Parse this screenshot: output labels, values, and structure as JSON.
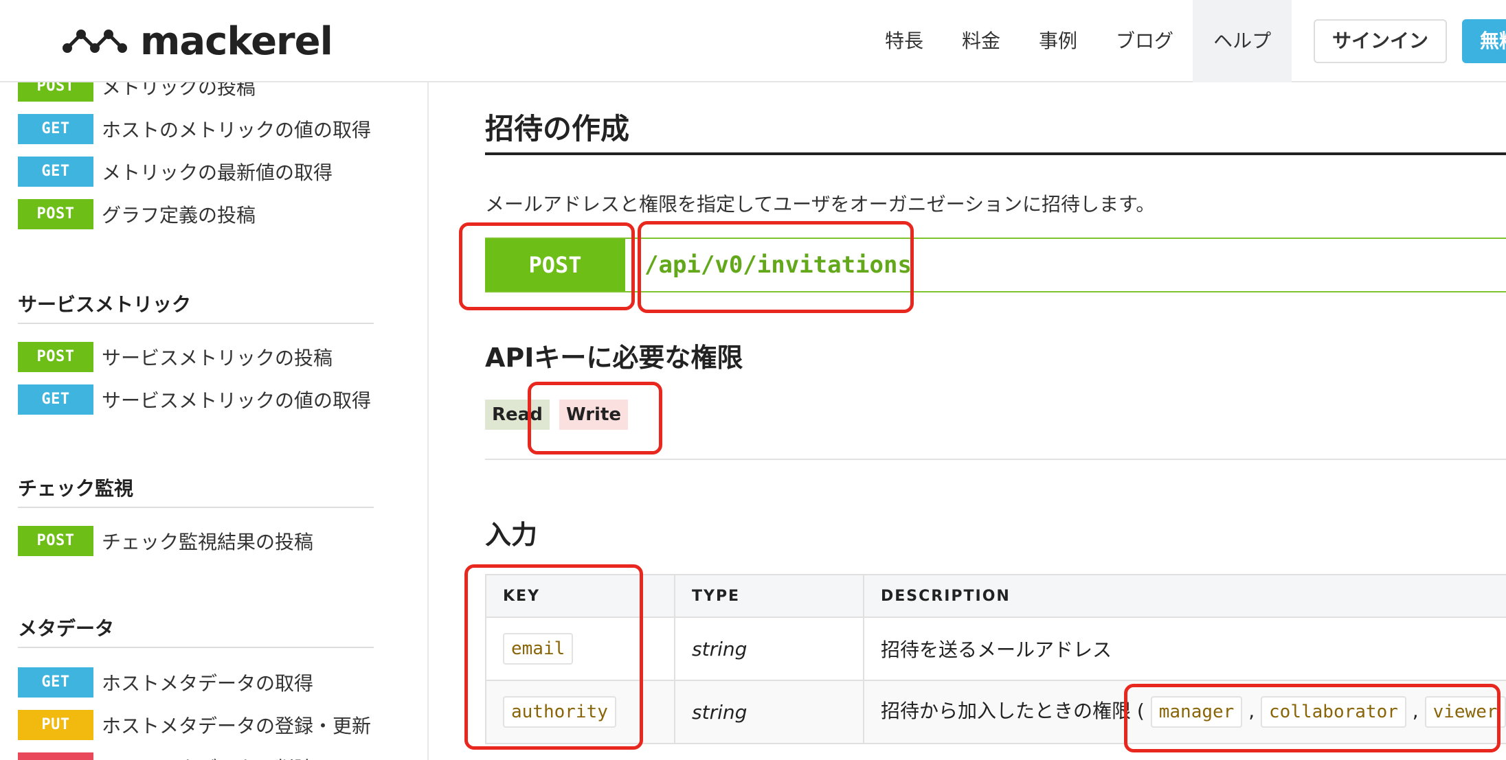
{
  "header": {
    "logo_text": "mackerel",
    "nav": [
      "特長",
      "料金",
      "事例",
      "ブログ",
      "ヘルプ"
    ],
    "signin_label": "サインイン",
    "signup_label": "無料"
  },
  "sidebar": {
    "items": [
      {
        "method": "POST",
        "label": "メトリックの投稿"
      },
      {
        "method": "GET",
        "label": "ホストのメトリックの値の取得"
      },
      {
        "method": "GET",
        "label": "メトリックの最新値の取得"
      },
      {
        "method": "POST",
        "label": "グラフ定義の投稿"
      },
      {
        "method": "POST",
        "label": "サービスメトリックの投稿"
      },
      {
        "method": "GET",
        "label": "サービスメトリックの値の取得"
      },
      {
        "method": "POST",
        "label": "チェック監視結果の投稿"
      },
      {
        "method": "GET",
        "label": "ホストメタデータの取得"
      },
      {
        "method": "PUT",
        "label": "ホストメタデータの登録・更新"
      },
      {
        "method": "DELETE",
        "label": "ホストメタデータの削除"
      }
    ],
    "sections": [
      "サービスメトリック",
      "チェック監視",
      "メタデータ"
    ]
  },
  "main": {
    "title": "招待の作成",
    "description": "メールアドレスと権限を指定してユーザをオーガニゼーションに招待します。",
    "endpoint": {
      "method": "POST",
      "path": "/api/v0/invitations"
    },
    "permissions_heading": "APIキーに必要な権限",
    "permissions": [
      "Read",
      "Write"
    ],
    "input_heading": "入力",
    "table": {
      "headers": [
        "KEY",
        "TYPE",
        "DESCRIPTION"
      ],
      "rows": [
        {
          "key": "email",
          "type": "string",
          "description": "招待を送るメールアドレス"
        },
        {
          "key": "authority",
          "type": "string",
          "description": "招待から加入したときの権限",
          "values": [
            "manager",
            "collaborator",
            "viewer"
          ]
        }
      ]
    }
  },
  "colors": {
    "post": "#6ebe18",
    "get": "#3fb4df",
    "put": "#f2b90f",
    "delete": "#e8485a",
    "annotation": "#e8271f",
    "signup": "#3bb2e0"
  }
}
